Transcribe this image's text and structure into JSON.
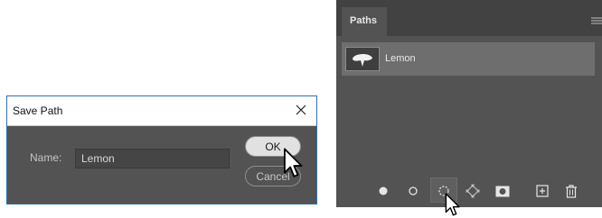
{
  "dialog": {
    "title": "Save Path",
    "name_label": "Name:",
    "name_value": "Lemon",
    "ok_label": "OK",
    "cancel_label": "Cancel"
  },
  "panel": {
    "tab_label": "Paths",
    "paths": [
      {
        "name": "Lemon",
        "thumbnail_icon": "lemon-shape-thumbnail"
      }
    ],
    "footer_icons": [
      "fill-path-icon",
      "stroke-path-icon",
      "load-path-as-selection-icon",
      "make-work-path-from-selection-icon",
      "add-mask-icon",
      "new-path-icon",
      "delete-path-icon"
    ]
  },
  "colors": {
    "dialog_border": "#2f6fb6",
    "panel_bg": "#535353",
    "selected_row": "#6e6e6e"
  }
}
